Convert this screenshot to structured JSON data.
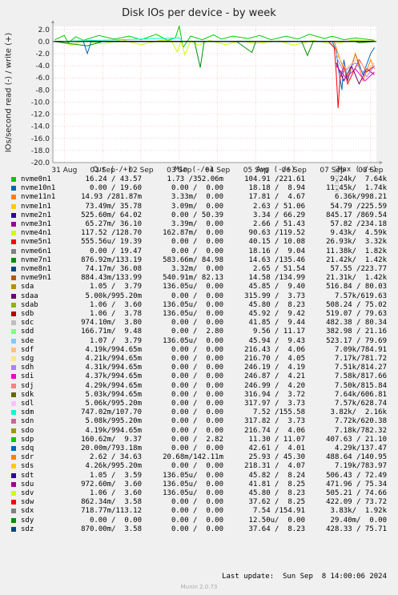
{
  "title": "Disk IOs per device - by week",
  "ylabel": "IOs/second read (-) / write (+)",
  "watermark": "RRDTOOL / TOBI OETIKER",
  "legend_headers": {
    "cur": "Cur (-/+)",
    "min": "Min (-/+)",
    "avg": "Avg (-/+)",
    "max": "Max (-/+)"
  },
  "rows": [
    {
      "name": "nvme0n1",
      "color": "#00cc00",
      "cur": "16.24 / 43.57",
      "min": "1.73 /352.06m",
      "avg": "104.91 /221.61",
      "max": "9.24k/  7.64k"
    },
    {
      "name": "nvme10n1",
      "color": "#0066b3",
      "cur": "0.00 / 19.60",
      "min": "0.00 /  0.00",
      "avg": "18.18 /  8.94",
      "max": "11.45k/  1.74k"
    },
    {
      "name": "nvme11n1",
      "color": "#ff8000",
      "cur": "14.93 /281.87m",
      "min": "3.33m/  0.00",
      "avg": "17.81 /  4.67",
      "max": "6.36k/998.21"
    },
    {
      "name": "nvme1n1",
      "color": "#ffcc00",
      "cur": "73.49m/ 35.78",
      "min": "3.09m/  0.00",
      "avg": "2.63 / 51.06",
      "max": "54.79 /225.59"
    },
    {
      "name": "nvme2n1",
      "color": "#330099",
      "cur": "525.60m/ 64.02",
      "min": "0.00 / 50.39",
      "avg": "3.34 / 66.29",
      "max": "845.17 /869.54"
    },
    {
      "name": "nvme3n1",
      "color": "#990099",
      "cur": "65.27m/ 36.10",
      "min": "3.39m/  0.00",
      "avg": "2.66 / 51.43",
      "max": "57.82 /234.18"
    },
    {
      "name": "nvme4n1",
      "color": "#ccff00",
      "cur": "117.52 /128.70",
      "min": "162.87m/  0.00",
      "avg": "90.63 /119.52",
      "max": "9.43k/  4.59k"
    },
    {
      "name": "nvme5n1",
      "color": "#ff0000",
      "cur": "555.56u/ 19.39",
      "min": "0.00 /  0.00",
      "avg": "40.15 / 10.08",
      "max": "26.93k/  3.32k"
    },
    {
      "name": "nvme6n1",
      "color": "#808080",
      "cur": "0.00 / 19.47",
      "min": "0.00 /  0.00",
      "avg": "18.16 /  9.04",
      "max": "11.38k/  1.82k"
    },
    {
      "name": "nvme7n1",
      "color": "#008f00",
      "cur": "876.92m/133.19",
      "min": "583.66m/ 84.98",
      "avg": "14.63 /135.46",
      "max": "21.42k/  1.42k"
    },
    {
      "name": "nvme8n1",
      "color": "#00487d",
      "cur": "74.17m/ 36.08",
      "min": "3.32m/  0.00",
      "avg": "2.65 / 51.54",
      "max": "57.55 /223.77"
    },
    {
      "name": "nvme9n1",
      "color": "#b35a00",
      "cur": "884.43m/133.99",
      "min": "540.91m/ 82.13",
      "avg": "14.58 /134.99",
      "max": "21.31k/  1.42k"
    },
    {
      "name": "sda",
      "color": "#b38f00",
      "cur": "1.05 /  3.79",
      "min": "136.05u/  0.00",
      "avg": "45.85 /  9.40",
      "max": "516.84 / 80.03"
    },
    {
      "name": "sdaa",
      "color": "#6b006b",
      "cur": "5.00k/995.20m",
      "min": "0.00 /  0.00",
      "avg": "315.99 /  3.73",
      "max": "7.57k/619.63"
    },
    {
      "name": "sdab",
      "color": "#8fb300",
      "cur": "1.06 /  3.60",
      "min": "136.05u/  0.00",
      "avg": "45.80 /  8.23",
      "max": "508.24 / 75.02"
    },
    {
      "name": "sdb",
      "color": "#b30000",
      "cur": "1.06 /  3.78",
      "min": "136.05u/  0.00",
      "avg": "45.92 /  9.42",
      "max": "519.07 / 79.63"
    },
    {
      "name": "sdc",
      "color": "#bebebe",
      "cur": "974.10m/  3.80",
      "min": "0.00 /  0.00",
      "avg": "41.85 /  9.44",
      "max": "482.38 / 80.34"
    },
    {
      "name": "sdd",
      "color": "#80ff80",
      "cur": "166.71m/  9.48",
      "min": "0.00 /  2.80",
      "avg": "9.56 / 11.17",
      "max": "382.98 / 21.16"
    },
    {
      "name": "sde",
      "color": "#80c9ff",
      "cur": "1.07 /  3.79",
      "min": "136.05u/  0.00",
      "avg": "45.94 /  9.43",
      "max": "523.17 / 79.69"
    },
    {
      "name": "sdf",
      "color": "#ffc080",
      "cur": "4.19k/994.65m",
      "min": "0.00 /  0.00",
      "avg": "216.43 /  4.06",
      "max": "7.09k/784.91"
    },
    {
      "name": "sdg",
      "color": "#ffe680",
      "cur": "4.21k/994.65m",
      "min": "0.00 /  0.00",
      "avg": "216.70 /  4.05",
      "max": "7.17k/781.72"
    },
    {
      "name": "sdh",
      "color": "#aa80ff",
      "cur": "4.31k/994.65m",
      "min": "0.00 /  0.00",
      "avg": "246.19 /  4.19",
      "max": "7.51k/814.27"
    },
    {
      "name": "sdi",
      "color": "#ee00cc",
      "cur": "4.37k/994.65m",
      "min": "0.00 /  0.00",
      "avg": "246.87 /  4.21",
      "max": "7.58k/817.66"
    },
    {
      "name": "sdj",
      "color": "#ff8080",
      "cur": "4.29k/994.65m",
      "min": "0.00 /  0.00",
      "avg": "246.99 /  4.20",
      "max": "7.50k/815.84"
    },
    {
      "name": "sdk",
      "color": "#666600",
      "cur": "5.03k/994.65m",
      "min": "0.00 /  0.00",
      "avg": "316.94 /  3.72",
      "max": "7.64k/606.81"
    },
    {
      "name": "sdl",
      "color": "#ffbfff",
      "cur": "5.06k/995.20m",
      "min": "0.00 /  0.00",
      "avg": "317.97 /  3.73",
      "max": "7.57k/628.74"
    },
    {
      "name": "sdm",
      "color": "#00ffcc",
      "cur": "747.02m/107.70",
      "min": "0.00 /  0.00",
      "avg": "7.52 /155.58",
      "max": "3.82k/  2.16k"
    },
    {
      "name": "sdn",
      "color": "#cc6699",
      "cur": "5.08k/995.20m",
      "min": "0.00 /  0.00",
      "avg": "317.82 /  3.73",
      "max": "7.72k/620.38"
    },
    {
      "name": "sdo",
      "color": "#999900",
      "cur": "4.19k/994.65m",
      "min": "0.00 /  0.00",
      "avg": "216.74 /  4.06",
      "max": "7.18k/782.32"
    },
    {
      "name": "sdp",
      "color": "#00cc00",
      "cur": "160.62m/  9.37",
      "min": "0.00 /  2.82",
      "avg": "11.30 / 11.07",
      "max": "407.63 / 21.10"
    },
    {
      "name": "sdq",
      "color": "#0066b3",
      "cur": "20.00m/793.18m",
      "min": "0.00 /  0.00",
      "avg": "42.61 /  4.01",
      "max": "4.29k/137.47"
    },
    {
      "name": "sdr",
      "color": "#ff8000",
      "cur": "2.62 / 34.63",
      "min": "20.68m/142.11m",
      "avg": "25.93 / 45.30",
      "max": "488.64 /140.95"
    },
    {
      "name": "sds",
      "color": "#ffcc00",
      "cur": "4.26k/995.20m",
      "min": "0.00 /  0.00",
      "avg": "218.31 /  4.07",
      "max": "7.19k/783.97"
    },
    {
      "name": "sdt",
      "color": "#330099",
      "cur": "1.05 /  3.59",
      "min": "136.05u/  0.00",
      "avg": "45.82 /  8.24",
      "max": "506.43 / 72.49"
    },
    {
      "name": "sdu",
      "color": "#990099",
      "cur": "972.60m/  3.60",
      "min": "136.05u/  0.00",
      "avg": "41.81 /  8.25",
      "max": "471.96 / 75.34"
    },
    {
      "name": "sdv",
      "color": "#ccff00",
      "cur": "1.06 /  3.60",
      "min": "136.05u/  0.00",
      "avg": "45.80 /  8.23",
      "max": "505.21 / 74.66"
    },
    {
      "name": "sdw",
      "color": "#ff0000",
      "cur": "862.34m/  3.58",
      "min": "0.00 /  0.00",
      "avg": "37.62 /  8.25",
      "max": "422.09 / 73.72"
    },
    {
      "name": "sdx",
      "color": "#808080",
      "cur": "718.77m/113.12",
      "min": "0.00 /  0.00",
      "avg": "7.54 /154.91",
      "max": "3.83k/  1.92k"
    },
    {
      "name": "sdy",
      "color": "#008f00",
      "cur": "0.00 /  0.00",
      "min": "0.00 /  0.00",
      "avg": "12.50u/  0.00",
      "max": "29.40m/  0.00"
    },
    {
      "name": "sdz",
      "color": "#00487d",
      "cur": "870.00m/  3.58",
      "min": "0.00 /  0.00",
      "avg": "37.64 /  8.23",
      "max": "428.33 / 75.71"
    }
  ],
  "last_update": "Last update:  Sun Sep  8 14:00:06 2024",
  "footer": "Munin 2.0.73",
  "chart_data": {
    "type": "line",
    "title": "Disk IOs per device - by week",
    "ylabel": "IOs/second read (-) / write (+)",
    "ylim": [
      -20.0,
      2.5
    ],
    "yticks": [
      "2.0",
      "0.0",
      "-2.0",
      "-4.0",
      "-6.0",
      "-8.0",
      "-10.0",
      "-12.0",
      "-14.0",
      "-16.0",
      "-18.0",
      "-20.0"
    ],
    "ytick_values": [
      2,
      0,
      -2,
      -4,
      -6,
      -8,
      -10,
      -12,
      -14,
      -16,
      -18,
      -20
    ],
    "xticks": [
      "31 Aug",
      "01 Sep",
      "02 Sep",
      "03 Sep",
      "04 Sep",
      "05 Sep",
      "06 Sep",
      "07 Sep",
      "08 Sep"
    ],
    "xtick_days": [
      0,
      1,
      2,
      3,
      4,
      5,
      6,
      7,
      8
    ],
    "xlim_days": [
      -0.3,
      8.15
    ],
    "grid": true,
    "series": [
      {
        "name": "nvme0n1",
        "color": "#00cc00",
        "points": [
          [
            -0.25,
            0.3
          ],
          [
            0.0,
            1.0
          ],
          [
            0.1,
            -0.2
          ],
          [
            0.3,
            0.8
          ],
          [
            0.5,
            0.2
          ],
          [
            0.9,
            1.0
          ],
          [
            1.3,
            0.4
          ],
          [
            1.7,
            0.9
          ],
          [
            2.0,
            0.3
          ],
          [
            2.4,
            1.2
          ],
          [
            2.7,
            0.2
          ],
          [
            2.9,
            0.6
          ],
          [
            3.0,
            2.6
          ],
          [
            3.1,
            -1.0
          ],
          [
            3.3,
            0.9
          ],
          [
            3.6,
            0.3
          ],
          [
            3.9,
            1.1
          ],
          [
            4.1,
            0.4
          ],
          [
            4.4,
            0.9
          ],
          [
            4.8,
            0.5
          ],
          [
            5.1,
            1.0
          ],
          [
            5.4,
            0.3
          ],
          [
            5.8,
            0.9
          ],
          [
            6.1,
            0.4
          ],
          [
            6.4,
            1.2
          ],
          [
            6.8,
            0.5
          ],
          [
            7.0,
            0.9
          ],
          [
            7.3,
            0.3
          ],
          [
            7.6,
            0.6
          ],
          [
            8.0,
            0.3
          ],
          [
            8.1,
            0.2
          ]
        ]
      },
      {
        "name": "nvme4n1",
        "color": "#ccff00",
        "points": [
          [
            -0.25,
            0.1
          ],
          [
            0.2,
            -0.6
          ],
          [
            0.5,
            0.2
          ],
          [
            1.0,
            -0.4
          ],
          [
            1.5,
            0.3
          ],
          [
            2.0,
            -0.5
          ],
          [
            2.5,
            0.2
          ],
          [
            2.8,
            0.1
          ],
          [
            2.95,
            -1.7
          ],
          [
            3.05,
            0.1
          ],
          [
            3.15,
            -2.2
          ],
          [
            3.3,
            0.1
          ],
          [
            3.5,
            -0.6
          ],
          [
            3.8,
            0.2
          ],
          [
            4.2,
            -0.5
          ],
          [
            4.6,
            0.1
          ],
          [
            5.0,
            -0.3
          ],
          [
            5.6,
            0.1
          ],
          [
            6.0,
            -0.6
          ],
          [
            6.5,
            0.2
          ],
          [
            7.0,
            -0.4
          ],
          [
            7.2,
            -0.2
          ],
          [
            7.5,
            0.2
          ],
          [
            8.1,
            0.1
          ]
        ]
      },
      {
        "name": "nvme7n1",
        "color": "#008f00",
        "points": [
          [
            -0.25,
            0.0
          ],
          [
            0.6,
            -0.7
          ],
          [
            1.0,
            0.0
          ],
          [
            2.0,
            0.0
          ],
          [
            3.4,
            0.0
          ],
          [
            3.55,
            -4.3
          ],
          [
            3.65,
            0.0
          ],
          [
            4.5,
            0.0
          ],
          [
            4.9,
            -1.8
          ],
          [
            5.0,
            0.0
          ],
          [
            6.2,
            0.0
          ],
          [
            6.35,
            -2.3
          ],
          [
            6.5,
            0.0
          ],
          [
            7.6,
            0.0
          ],
          [
            7.7,
            -0.2
          ],
          [
            8.1,
            0.0
          ]
        ]
      },
      {
        "name": "nvme10n1",
        "color": "#0066b3",
        "points": [
          [
            -0.25,
            0.0
          ],
          [
            0.5,
            0.0
          ],
          [
            0.6,
            -2.0
          ],
          [
            0.7,
            0.0
          ],
          [
            7.0,
            0.0
          ],
          [
            7.1,
            -1.5
          ],
          [
            7.15,
            -4.2
          ],
          [
            7.25,
            -8.0
          ],
          [
            7.3,
            -3.0
          ],
          [
            7.4,
            -6.5
          ],
          [
            7.6,
            -2.0
          ],
          [
            7.8,
            -5.5
          ],
          [
            8.0,
            -2.0
          ],
          [
            8.1,
            -1.0
          ]
        ]
      },
      {
        "name": "nvme5n1",
        "color": "#ff0000",
        "points": [
          [
            6.9,
            0.0
          ],
          [
            7.05,
            -1.0
          ],
          [
            7.1,
            -5.0
          ],
          [
            7.15,
            -11.0
          ],
          [
            7.2,
            -6.0
          ],
          [
            7.3,
            -4.0
          ],
          [
            7.4,
            -7.0
          ],
          [
            7.55,
            -5.0
          ],
          [
            7.7,
            -3.0
          ],
          [
            7.9,
            -5.0
          ],
          [
            8.1,
            -4.0
          ]
        ]
      },
      {
        "name": "nvme11n1",
        "color": "#ff8000",
        "points": [
          [
            7.05,
            0.0
          ],
          [
            7.2,
            -3.0
          ],
          [
            7.4,
            -6.0
          ],
          [
            7.6,
            -2.0
          ],
          [
            7.8,
            -6.5
          ],
          [
            8.0,
            -3.0
          ],
          [
            8.1,
            -4.5
          ]
        ]
      },
      {
        "name": "nvme2n1",
        "color": "#330099",
        "points": [
          [
            -0.25,
            0.05
          ],
          [
            8.1,
            0.05
          ]
        ]
      },
      {
        "name": "sdaa",
        "color": "#6b006b",
        "points": [
          [
            7.1,
            -3.5
          ],
          [
            7.3,
            -6.5
          ],
          [
            7.5,
            -4.0
          ],
          [
            7.7,
            -7.0
          ],
          [
            7.9,
            -4.5
          ],
          [
            8.1,
            -5.5
          ]
        ]
      },
      {
        "name": "sdh",
        "color": "#aa80ff",
        "points": [
          [
            7.1,
            -2.5
          ],
          [
            7.3,
            -5.0
          ],
          [
            7.6,
            -3.5
          ],
          [
            7.9,
            -5.8
          ],
          [
            8.1,
            -4.0
          ]
        ]
      },
      {
        "name": "sdi",
        "color": "#ee00cc",
        "points": [
          [
            7.1,
            -4.0
          ],
          [
            7.35,
            -6.0
          ],
          [
            7.6,
            -4.5
          ],
          [
            7.85,
            -6.5
          ],
          [
            8.1,
            -5.0
          ]
        ]
      },
      {
        "name": "sdf",
        "color": "#ffc080",
        "points": [
          [
            7.1,
            -2.0
          ],
          [
            7.35,
            -4.5
          ],
          [
            7.65,
            -2.8
          ],
          [
            7.9,
            -4.8
          ],
          [
            8.1,
            -3.5
          ]
        ]
      },
      {
        "name": "sdm",
        "color": "#00ffcc",
        "points": [
          [
            -0.25,
            0.0
          ],
          [
            3.0,
            0.6
          ],
          [
            3.1,
            0.0
          ],
          [
            8.1,
            0.0
          ]
        ]
      }
    ]
  }
}
